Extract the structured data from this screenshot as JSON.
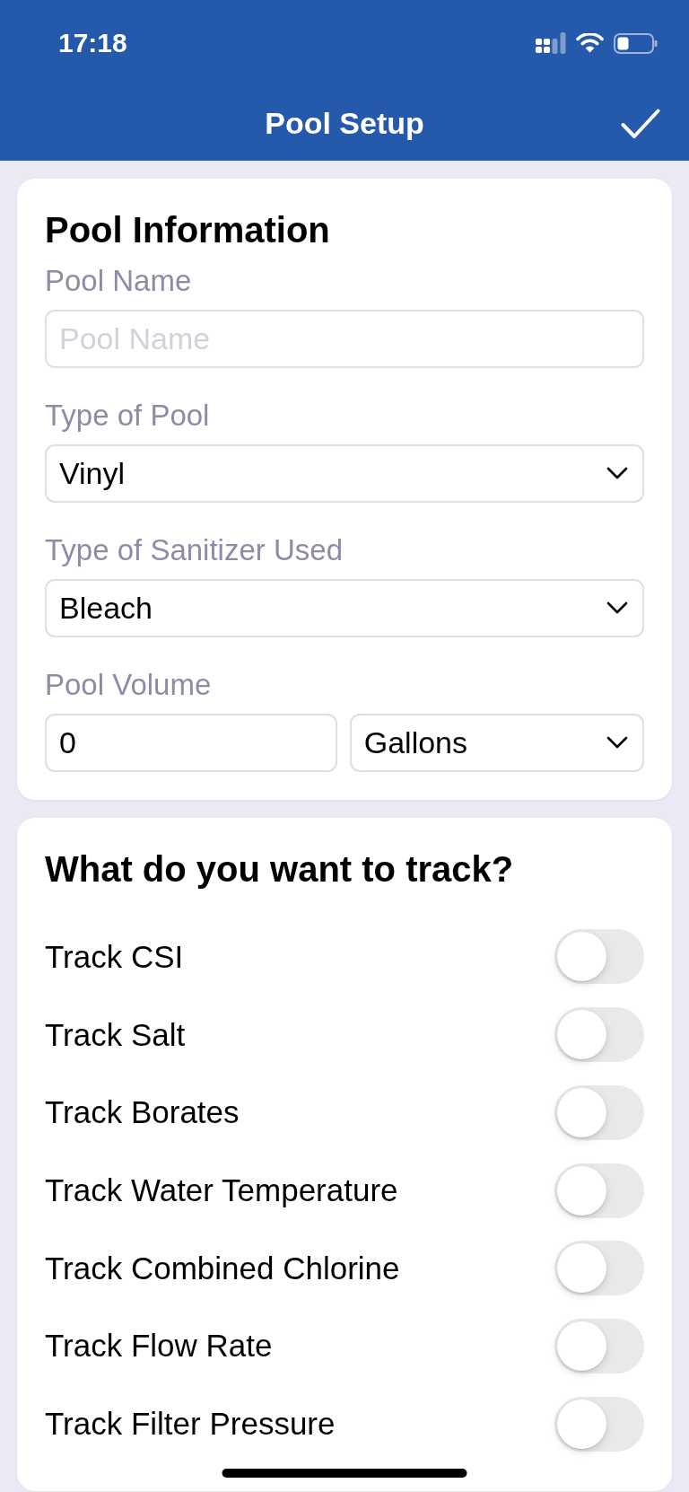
{
  "status_bar": {
    "time": "17:18"
  },
  "nav_bar": {
    "title": "Pool Setup"
  },
  "pool_information": {
    "title": "Pool Information",
    "fields": [
      {
        "kind": "text",
        "label": "Pool Name",
        "placeholder": "Pool Name"
      },
      {
        "kind": "select",
        "label": "Type of Pool",
        "value": "Vinyl"
      },
      {
        "kind": "select",
        "label": "Type of Sanitizer Used",
        "value": "Bleach"
      },
      {
        "kind": "pair",
        "label": "Pool Volume",
        "value": "0",
        "unit": "Gallons"
      }
    ]
  },
  "tracking": {
    "title": "What do you want to track?",
    "toggles": [
      {
        "label": "Track CSI",
        "on": false
      },
      {
        "label": "Track Salt",
        "on": false
      },
      {
        "label": "Track Borates",
        "on": false
      },
      {
        "label": "Track Water Temperature",
        "on": false
      },
      {
        "label": "Track Combined Chlorine",
        "on": false
      },
      {
        "label": "Track Flow Rate",
        "on": false
      },
      {
        "label": "Track Filter Pressure",
        "on": false
      }
    ]
  }
}
